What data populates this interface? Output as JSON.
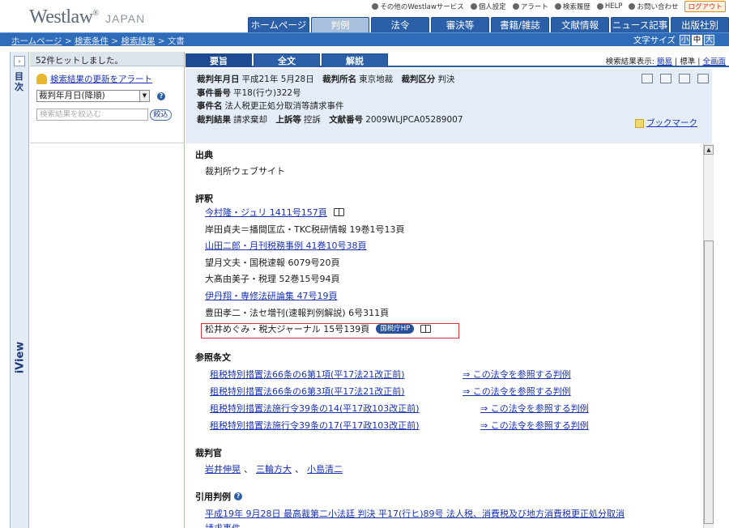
{
  "header": {
    "logo_main": "Westlaw",
    "logo_mark": "®",
    "logo_sub": "JAPAN",
    "util_links": [
      {
        "label": "その他のWestlawサービス",
        "icon": "circle-arrow-icon"
      },
      {
        "label": "個人設定",
        "icon": "person-icon"
      },
      {
        "label": "アラート",
        "icon": "alert-icon"
      },
      {
        "label": "検索履歴",
        "icon": "magnifier-icon"
      },
      {
        "label": "HELP",
        "icon": "help-icon"
      },
      {
        "label": "お問い合わせ",
        "icon": "mail-icon"
      }
    ],
    "logout_label": "ログアウト",
    "tabs": [
      {
        "label": "ホームページ",
        "w": 76
      },
      {
        "label": "判例",
        "w": 70,
        "active": true
      },
      {
        "label": "法令",
        "w": 70
      },
      {
        "label": "審決等",
        "w": 70
      },
      {
        "label": "書籍/雑誌",
        "w": 70
      },
      {
        "label": "文献情報",
        "w": 70
      },
      {
        "label": "ニュース記事",
        "w": 70
      },
      {
        "label": "出版社別",
        "w": 70
      }
    ]
  },
  "breadcrumb": {
    "items": [
      "ホームページ",
      "検索条件",
      "検索結果"
    ],
    "current": "文書",
    "sep": " > "
  },
  "font_size": {
    "label": "文字サイズ",
    "options": [
      "小",
      "中",
      "大"
    ],
    "selected": "中"
  },
  "rail": {
    "toggle": "›",
    "toc": "目次",
    "iview": "iView"
  },
  "left_panel": {
    "hit_count": "52件ヒットしました。",
    "alert_link": "検索結果の更新をアラート",
    "sort_value": "裁判年月日(降順)",
    "narrow_placeholder": "検索結果を絞込む",
    "narrow_button": "絞込"
  },
  "content_tabs": [
    {
      "label": "要旨",
      "active": true
    },
    {
      "label": "全文"
    },
    {
      "label": "解説"
    }
  ],
  "view_mode": {
    "label": "検索結果表示:",
    "options": [
      "簡易",
      "標準",
      "全画面"
    ],
    "selected": "標準"
  },
  "case_info": {
    "date_label": "裁判年月日",
    "date": "平成21年 5月28日",
    "court_label": "裁判所名",
    "court": "東京地裁",
    "type_label": "裁判区分",
    "type": "判決",
    "case_no_label": "事件番号",
    "case_no": "平18(行ウ)322号",
    "case_name_label": "事件名",
    "case_name": "法人税更正処分取消等請求事件",
    "result_label": "裁判結果",
    "result": "請求棄却",
    "appeal_label": "上訴等",
    "appeal": "控訴",
    "doc_no_label": "文献番号",
    "doc_no": "2009WLJPCA05289007",
    "bookmark": "ブックマーク"
  },
  "doc": {
    "source_title": "出典",
    "source": "裁判所ウェブサイト",
    "review_title": "評釈",
    "reviews": [
      {
        "text": "今村隆・ジュリ 1411号157頁",
        "link": true,
        "book": true
      },
      {
        "text": "岸田貞夫＝播間匡広・TKC税研情報 19巻1号13頁"
      },
      {
        "text": "山田二郎・月刊税務事例 41巻10号38頁",
        "link": true
      },
      {
        "text": "望月文夫・国税速報 6079号20頁"
      },
      {
        "text": "大髙由美子・税理 52巻15号94頁"
      },
      {
        "text": "伊丹翔・専修法研論集 47号19頁",
        "link": true
      },
      {
        "text": "豊田孝二・法セ増刊(速報判例解説) 6号311頁"
      },
      {
        "text": "松井めぐみ・税大ジャーナル 15号139頁",
        "badge": "国税庁HP",
        "book": true
      }
    ],
    "ref_title": "参照条文",
    "refs": [
      {
        "law": "租税特別措置法66条の6第1項(平17法21改正前)",
        "see": "⇒ この法令を参照する判例"
      },
      {
        "law": "租税特別措置法66条の6第3項(平17法21改正前)",
        "see": "⇒ この法令を参照する判例"
      },
      {
        "law": "租税特別措置法施行令39条の14(平17政103改正前)",
        "see": "⇒ この法令を参照する判例"
      },
      {
        "law": "租税特別措置法施行令39条の17(平17政103改正前)",
        "see": "⇒ この法令を参照する判例"
      }
    ],
    "judge_title": "裁判官",
    "judges": [
      "岩井伸晃",
      "三輪方大",
      "小島清二"
    ],
    "judge_sep": "、",
    "cited_title": "引用判例",
    "cited_line1": "平成19年 9月28日 最高裁第二小法廷 判決 平17(行ヒ)89号 法人税、消費税及び地方消費税更正処分取消",
    "cited_line2": "請求事件"
  }
}
